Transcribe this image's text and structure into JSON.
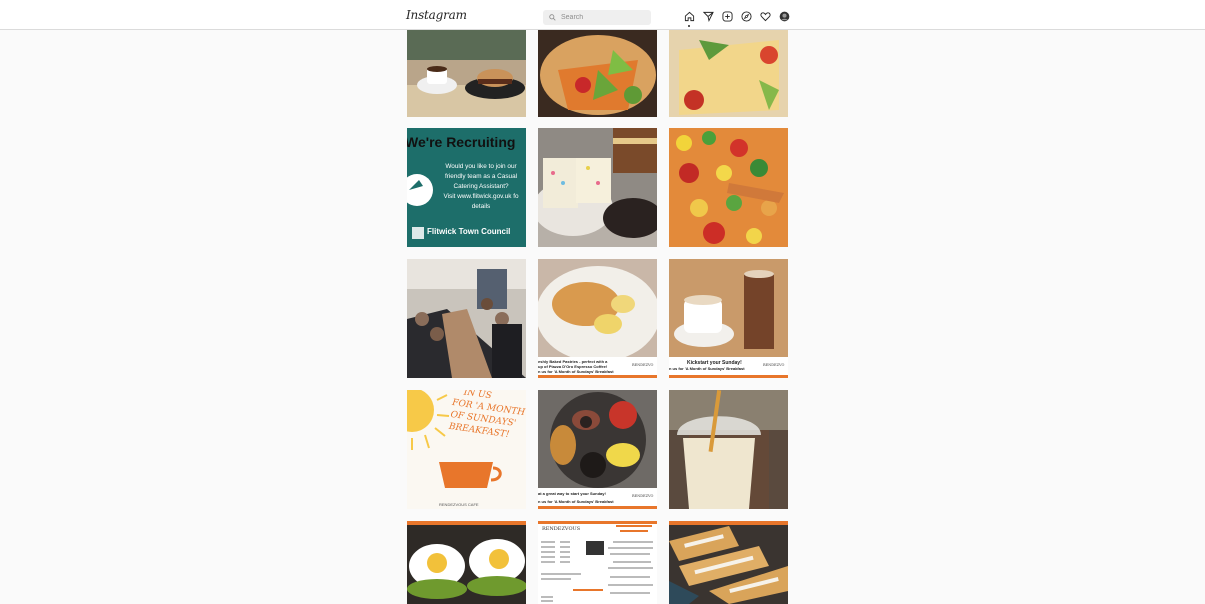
{
  "header": {
    "logo": "Instagram",
    "search_placeholder": "Search",
    "nav_icons": [
      "home-icon",
      "direct-icon",
      "new-post-icon",
      "explore-icon",
      "activity-icon",
      "profile-avatar"
    ]
  },
  "posts": {
    "recruiting": {
      "title": "We're Recruiting",
      "body_lines": [
        "Would you like to join our",
        "friendly team as a Casual",
        "Catering Assistant?",
        "Visit www.flitwick.gov.uk fo",
        "details"
      ],
      "footer": "Flitwick Town Council"
    },
    "pastries": {
      "caption_line1": "eshly Baked Pastries - perfect with a",
      "caption_line2": "up of Piazza D'Oro Espresso Coffee!",
      "caption_line3": "n us for 'A Month of Sundays' Breakfast",
      "brand": "RENDEZVO"
    },
    "coffee": {
      "caption_line1": "Kickstart your Sunday!",
      "caption_line2": "n us for 'A Month of Sundays' Breakfast",
      "brand": "RENDEZVO"
    },
    "breakfast_poster": {
      "line1": "IN US",
      "line2": "FOR 'A MONTH",
      "line3": "OF SUNDAYS'",
      "line4": "BREAKFAST!",
      "footer": "RENDEZVOUS CAFE"
    },
    "full_breakfast": {
      "caption_line1": "at a great way to start your Sunday!",
      "caption_line2": "n us for 'A Month of Sundays' Breakfast",
      "brand": "RENDEZVO"
    },
    "menu": {
      "heading": "RENDEZVOUS"
    }
  },
  "colors": {
    "teal": "#1d6e6a",
    "orange": "#e8762b",
    "border": "#dbdbdb",
    "text": "#262626"
  }
}
